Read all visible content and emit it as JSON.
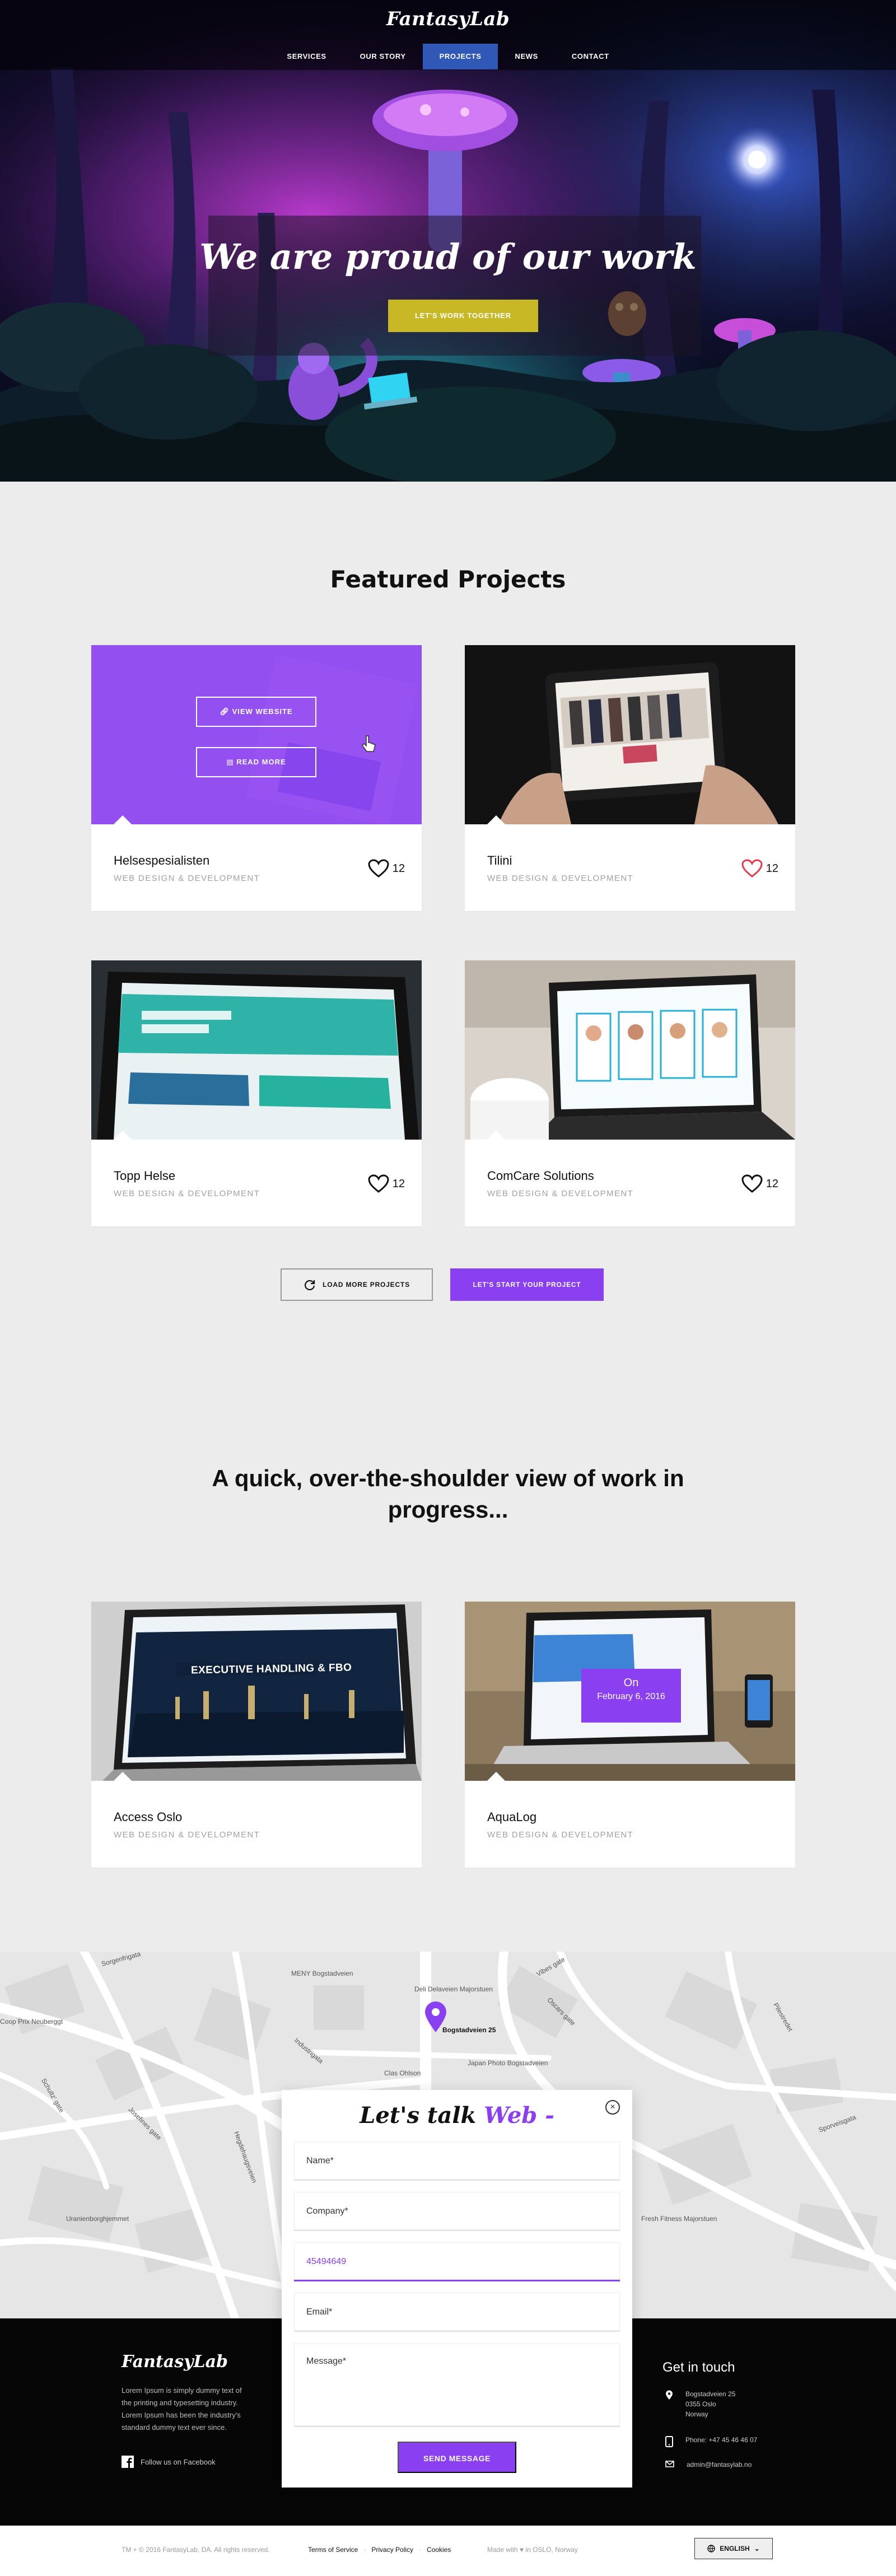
{
  "header": {
    "logo": "FantasyLab",
    "nav": [
      {
        "label": "SERVICES",
        "active": false
      },
      {
        "label": "OUR STORY",
        "active": false
      },
      {
        "label": "PROJECTS",
        "active": true
      },
      {
        "label": "NEWS",
        "active": false
      },
      {
        "label": "CONTACT",
        "active": false
      }
    ]
  },
  "hero": {
    "title": "We are proud of our work",
    "cta": "LET'S WORK TOGETHER"
  },
  "featured": {
    "title": "Featured Projects",
    "overlay_buttons": {
      "view": "VIEW WEBSITE",
      "read": "READ MORE"
    },
    "projects": [
      {
        "title": "Helsespesialisten",
        "category": "WEB DESIGN & DEVELOPMENT",
        "likes": "12",
        "liked": false
      },
      {
        "title": "Tilini",
        "category": "WEB DESIGN & DEVELOPMENT",
        "likes": "12",
        "liked": true
      },
      {
        "title": "Topp Helse",
        "category": "WEB DESIGN & DEVELOPMENT",
        "likes": "12",
        "liked": false
      },
      {
        "title": "ComCare Solutions",
        "category": "WEB DESIGN & DEVELOPMENT",
        "likes": "12",
        "liked": false
      }
    ],
    "load_more": "LOAD MORE PROJECTS",
    "start_project": "LET'S START YOUR PROJECT"
  },
  "wip": {
    "title": "A quick, over-the-shoulder view of work in progress...",
    "projects": [
      {
        "title": "Access Oslo",
        "category": "WEB DESIGN & DEVELOPMENT",
        "screen_text": "EXECUTIVE HANDLING & FBO"
      },
      {
        "title": "AquaLog",
        "category": "WEB DESIGN & DEVELOPMENT",
        "screen_text": "On",
        "screen_date": "February 6, 2016"
      }
    ]
  },
  "map": {
    "pin_label": "Bogstadveien 25",
    "labels": [
      "MENY Bogstadveien",
      "Deli Delaveien Majorstuen",
      "Japan Photo Bogstadveien",
      "Clas Ohlson",
      "Coop Prix Neuberggt",
      "Uranienborghjemmet",
      "Fresh Fitness Majorstuen",
      "Sorgenfrigata",
      "Industrigata",
      "Hegdehaugsveien",
      "Josefines gate",
      "Vibes gate",
      "Oscars gate",
      "Pilestredet",
      "Schultz' gate",
      "Sporveisgata"
    ]
  },
  "contact_form": {
    "title_prefix": "Let's talk",
    "title_highlight": "Web",
    "title_suffix": "-",
    "fields": [
      {
        "name": "Name*",
        "value": "",
        "active": false
      },
      {
        "name": "Company*",
        "value": "",
        "active": false
      },
      {
        "name": "Phone",
        "value": "45494649",
        "active": true
      },
      {
        "name": "Email*",
        "value": "",
        "active": false
      },
      {
        "name": "Message*",
        "value": "",
        "active": false
      }
    ],
    "send": "SEND MESSAGE"
  },
  "footer": {
    "logo": "FantasyLab",
    "description": "Lorem Ipsum is simply dummy text of the printing and typesetting industry. Lorem Ipsum has been the industry's standard dummy text ever since.",
    "facebook": "Follow us on Facebook",
    "get_in_touch": "Get in touch",
    "address": [
      "Bogstadveien 25",
      "0355 Oslo",
      "Norway"
    ],
    "phone": "Phone: +47 45 46 46 07",
    "email": "admin@fantasylab.no"
  },
  "bottom": {
    "copyright": "TM + © 2016 FantasyLab, DA. All rights reserved.",
    "links": [
      "Terms of Service",
      "Privacy Policy",
      "Cookies"
    ],
    "made_with": "Made with ♥ in OSLO, Norway",
    "language": "ENGLISH"
  },
  "colors": {
    "accent": "#8a3ff0",
    "nav_active": "#2f58b7",
    "cta_yellow": "#c9b826",
    "liked_heart": "#e53950"
  }
}
